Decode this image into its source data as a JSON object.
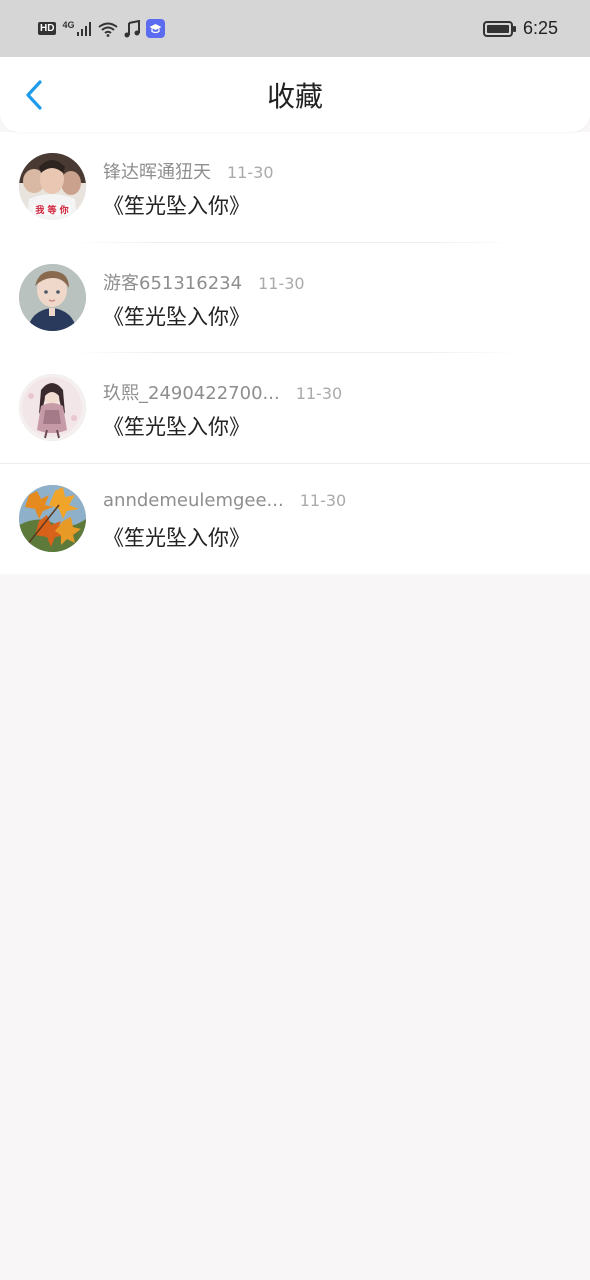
{
  "status_bar": {
    "hd": "HD",
    "network": "4G",
    "time": "6:25"
  },
  "nav": {
    "title": "收藏"
  },
  "favorites": [
    {
      "user": "锋达晖通狃天",
      "date": "11-30",
      "title": "《笙光坠入你》"
    },
    {
      "user": "游客651316234",
      "date": "11-30",
      "title": "《笙光坠入你》"
    },
    {
      "user": "玖熙_2490422700...",
      "date": "11-30",
      "title": "《笙光坠入你》"
    },
    {
      "user": "anndemeulemgee...",
      "date": "11-30",
      "title": "《笙光坠入你》"
    }
  ],
  "colors": {
    "accent": "#1e9bea",
    "status_bar_bg": "#d6d6d6",
    "page_bg": "#f8f6f7"
  }
}
